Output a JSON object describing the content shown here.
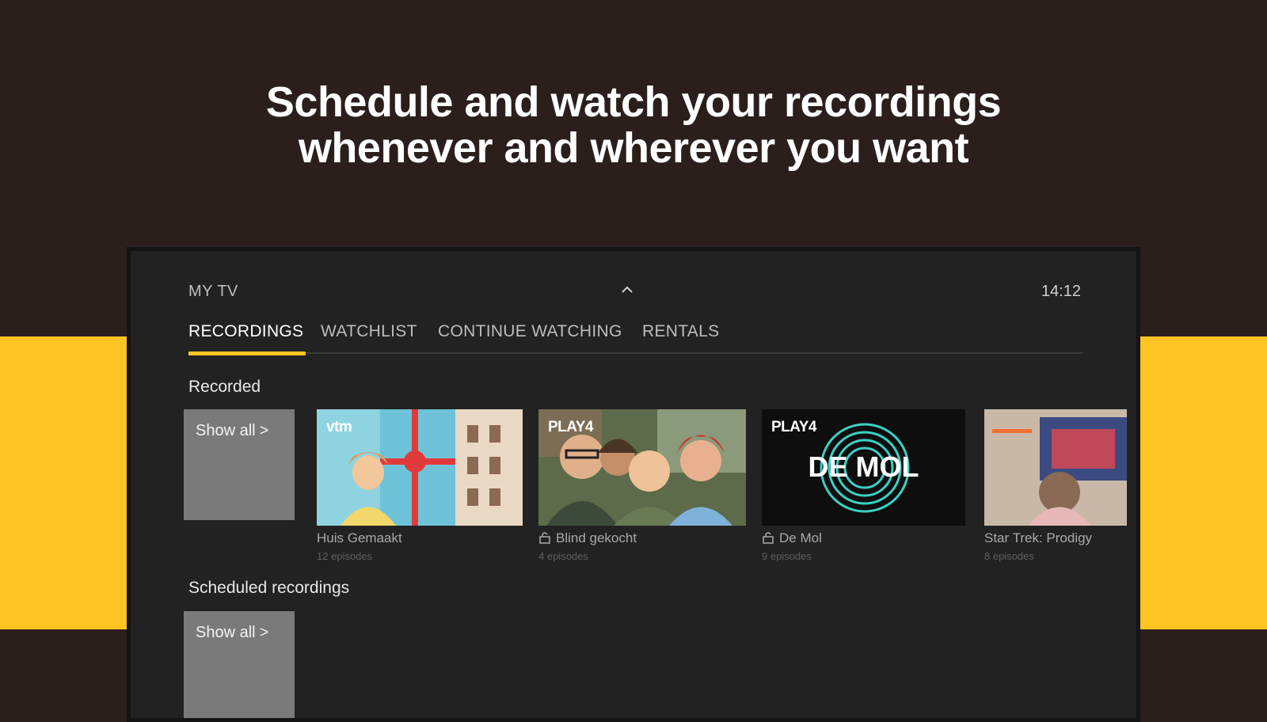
{
  "headline": {
    "line1": "Schedule and watch your recordings",
    "line2": "whenever and wherever you want"
  },
  "colors": {
    "accent": "#fdc423",
    "background": "#2b1f1c",
    "panel": "#222222"
  },
  "tv": {
    "section": "MY TV",
    "clock": "14:12",
    "tabs": [
      {
        "label": "RECORDINGS",
        "active": true
      },
      {
        "label": "WATCHLIST",
        "active": false
      },
      {
        "label": "CONTINUE WATCHING",
        "active": false
      },
      {
        "label": "RENTALS",
        "active": false
      }
    ],
    "recorded": {
      "title": "Recorded",
      "show_all": "Show all",
      "items": [
        {
          "title": "Huis Gemaakt",
          "subtitle": "12 episodes",
          "channel": "vtm",
          "locked": false
        },
        {
          "title": "Blind gekocht",
          "subtitle": "4 episodes",
          "channel": "PLAY4",
          "locked": true
        },
        {
          "title": "De Mol",
          "subtitle": "9 episodes",
          "channel": "PLAY4",
          "locked": true,
          "artwork_text": "DE MOL"
        },
        {
          "title": "Star Trek: Prodigy",
          "subtitle": "8 episodes",
          "channel": "",
          "locked": false
        }
      ]
    },
    "scheduled": {
      "title": "Scheduled recordings",
      "show_all": "Show all"
    }
  }
}
